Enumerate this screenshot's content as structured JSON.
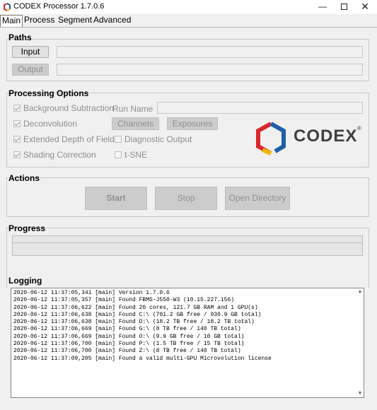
{
  "window": {
    "title": "CODEX Processor 1.7.0.6",
    "minimize": "—",
    "close": "✕"
  },
  "tabs": [
    {
      "label": "Main",
      "active": true
    },
    {
      "label": "Process"
    },
    {
      "label": "Segment"
    },
    {
      "label": "Advanced"
    }
  ],
  "paths": {
    "title": "Paths",
    "input_label": "Input",
    "input_value": "",
    "output_label": "Output",
    "output_value": ""
  },
  "processing": {
    "title": "Processing Options",
    "background_subtraction": {
      "label": "Background Subtraction",
      "checked": true
    },
    "deconvolution": {
      "label": "Deconvolution",
      "checked": true
    },
    "extended_dof": {
      "label": "Extended Depth of Field",
      "checked": true
    },
    "shading_correction": {
      "label": "Shading Correction",
      "checked": true
    },
    "run_name_label": "Run Name",
    "run_name_value": "",
    "channels_label": "Channels",
    "exposures_label": "Exposures",
    "diagnostic_output": {
      "label": "Diagnostic Output",
      "checked": false
    },
    "tsne": {
      "label": "t-SNE",
      "checked": false
    },
    "logo_text": "CODEX",
    "logo_reg": "®"
  },
  "actions": {
    "title": "Actions",
    "start_label": "Start",
    "stop_label": "Stop",
    "open_dir_label": "Open Directory"
  },
  "progress": {
    "title": "Progress",
    "value": 0
  },
  "logging": {
    "title": "Logging",
    "lines": [
      "2020-06-12 11:37:05,341 [main] Version 1.7.0.6",
      "2020-06-12 11:37:05,357 [main] Found FBMS-J550-W3 (10.15.227.156)",
      "2020-06-12 11:37:06,622 [main] Found 20 cores, 121.7 GB RAM and 1 GPU(s)",
      "2020-06-12 11:37:06,638 [main] Found C:\\ (701.2 GB free / 930.9 GB total)",
      "2020-06-12 11:37:06,638 [main] Found D:\\ (18.2 TB free / 18.2 TB total)",
      "2020-06-12 11:37:06,669 [main] Found G:\\ (8 TB free / 140 TB total)",
      "2020-06-12 11:37:06,669 [main] Found O:\\ (9.9 GB free / 10 GB total)",
      "2020-06-12 11:37:06,700 [main] Found P:\\ (1.5 TB free / 15 TB total)",
      "2020-06-12 11:37:06,700 [main] Found Z:\\ (8 TB free / 140 TB total)",
      "2020-06-12 11:37:09,205 [main] Found a valid multi-GPU Microvolution license"
    ]
  },
  "colors": {
    "logo_red": "#d9262c",
    "logo_yellow": "#f2b705",
    "logo_blue": "#1f5fa8",
    "logo_text": "#3f3f3f"
  }
}
